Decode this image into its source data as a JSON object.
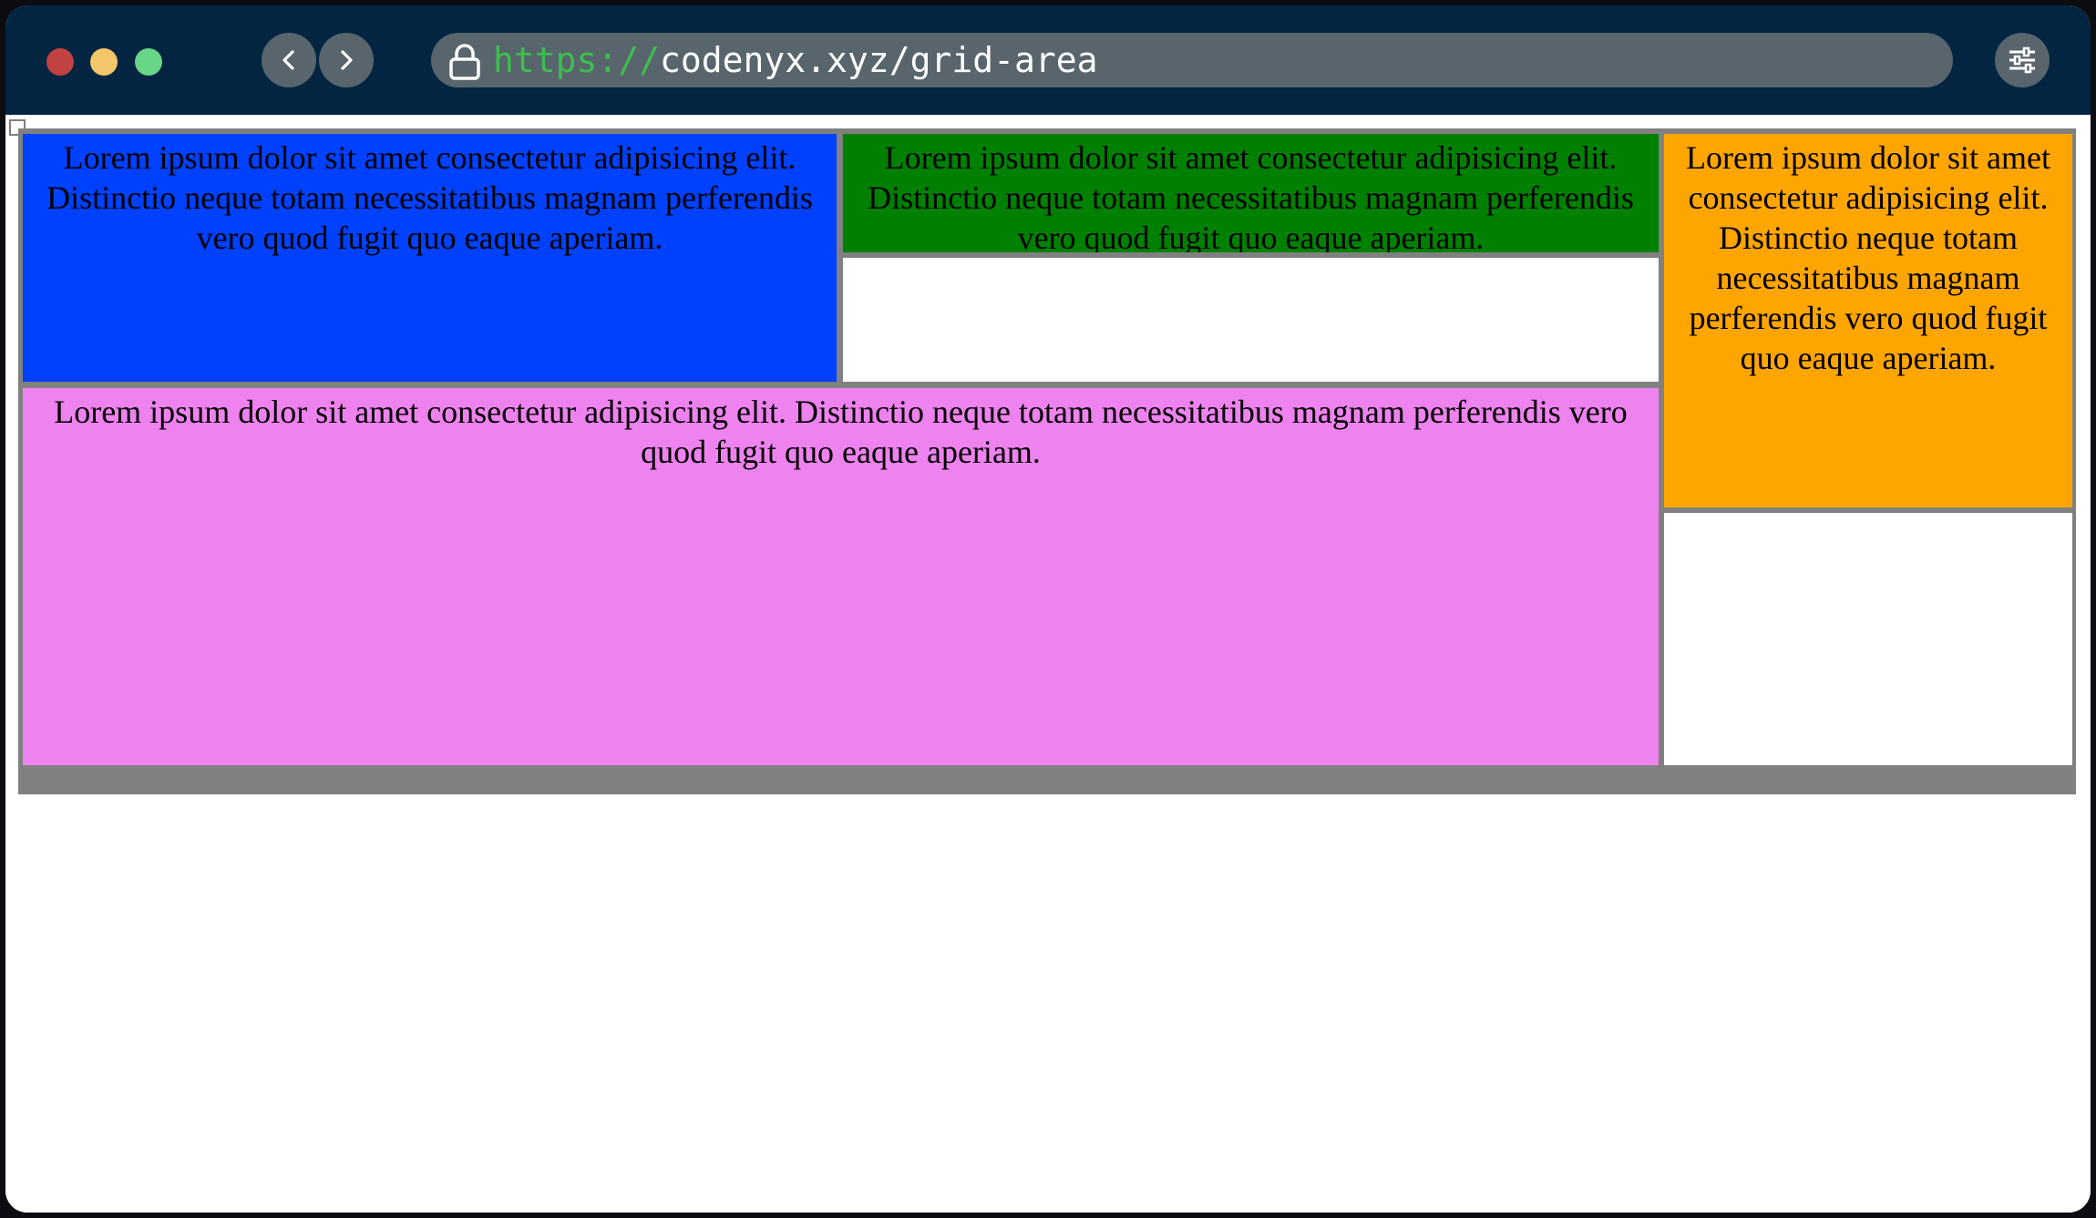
{
  "browser": {
    "url_protocol": "https://",
    "url_path": "codenyx.xyz/grid-area"
  },
  "colors": {
    "titlebar": "#032541",
    "url_protocol": "#3cbf4e",
    "grid_background": "#808080",
    "item1": "#0040ff",
    "item2": "#008000",
    "item3": "#ffa500",
    "item4": "#ee82ee"
  },
  "icons": {
    "back": "chevron-left-icon",
    "forward": "chevron-right-icon",
    "lock": "lock-icon",
    "settings": "sliders-icon"
  },
  "grid": {
    "items": [
      {
        "text": "Lorem ipsum dolor sit amet consectetur adipisicing elit. Distinctio neque totam necessitatibus magnam perferendis vero quod fugit quo eaque aperiam."
      },
      {
        "text": "Lorem ipsum dolor sit amet consectetur adipisicing elit. Distinctio neque totam necessitatibus magnam perferendis vero quod fugit quo eaque aperiam."
      },
      {
        "text": "Lorem ipsum dolor sit amet consectetur adipisicing elit. Distinctio neque totam necessitatibus magnam perferendis vero quod fugit quo eaque aperiam."
      },
      {
        "text": "Lorem ipsum dolor sit amet consectetur adipisicing elit. Distinctio neque totam necessitatibus magnam perferendis vero quod fugit quo eaque aperiam."
      }
    ]
  }
}
